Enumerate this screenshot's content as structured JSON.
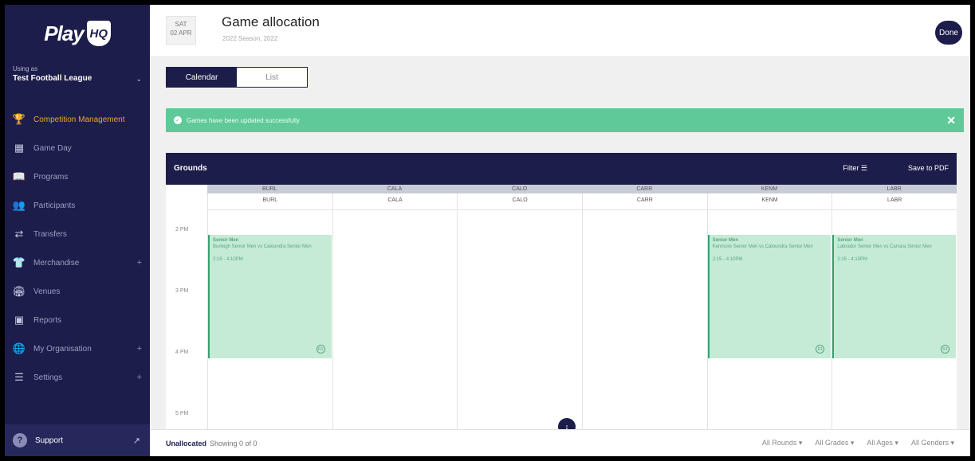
{
  "app": {
    "logo_text": "Play",
    "logo_mark": "HQ"
  },
  "sidebar": {
    "org_label": "Using as",
    "org_name": "Test Football League",
    "items": [
      {
        "label": "Competition Management",
        "icon": "trophy-icon",
        "active": true
      },
      {
        "label": "Game Day",
        "icon": "scoreboard-icon"
      },
      {
        "label": "Programs",
        "icon": "book-icon"
      },
      {
        "label": "Participants",
        "icon": "people-icon"
      },
      {
        "label": "Transfers",
        "icon": "transfer-icon"
      },
      {
        "label": "Merchandise",
        "icon": "shirt-icon",
        "expandable": true
      },
      {
        "label": "Venues",
        "icon": "stadium-icon"
      },
      {
        "label": "Reports",
        "icon": "report-icon"
      },
      {
        "label": "My Organisation",
        "icon": "globe-icon",
        "expandable": true
      },
      {
        "label": "Settings",
        "icon": "sliders-icon",
        "expandable": true
      }
    ],
    "support_label": "Support"
  },
  "header": {
    "day": "SAT",
    "date": "02 APR",
    "title": "Game allocation",
    "subtitle": "2022 Season, 2022",
    "done_label": "Done"
  },
  "tabs": [
    {
      "label": "Calendar",
      "active": true
    },
    {
      "label": "List",
      "active": false
    }
  ],
  "banner": {
    "message": "Games have been updated successfully"
  },
  "calendar": {
    "grounds_label": "Grounds",
    "filter_label": "Filter ☰",
    "pdf_label": "Save to PDF",
    "columns": [
      "BURL",
      "CALA",
      "CALO",
      "CARR",
      "KENM",
      "LABR"
    ],
    "times": [
      "2 PM",
      "3 PM",
      "4 PM",
      "5 PM"
    ],
    "events": [
      {
        "col": 0,
        "grade": "Senior Men",
        "match": "Burleigh Senior Men vs Caloundra Senior Men",
        "time": "2:15 - 4:10PM",
        "badge": "R1"
      },
      {
        "col": 4,
        "grade": "Senior Men",
        "match": "Kenmore Senior Men vs Caloundra Senior Men",
        "time": "2:15 - 4:10PM",
        "badge": "R1"
      },
      {
        "col": 5,
        "grade": "Senior Men",
        "match": "Labrador Senior Men vs Carrara Senior Men",
        "time": "2:15 - 4:10PM",
        "badge": "R1"
      }
    ]
  },
  "bottom": {
    "unallocated_label": "Unallocated",
    "showing": "Showing 0 of 0",
    "filters": [
      "All Rounds ▾",
      "All Grades ▾",
      "All Ages ▾",
      "All Genders ▾"
    ]
  },
  "colors": {
    "navy": "#1c1d4a",
    "accent": "#f0a52a",
    "success": "#60c99a",
    "event": "#c5ebd6"
  }
}
